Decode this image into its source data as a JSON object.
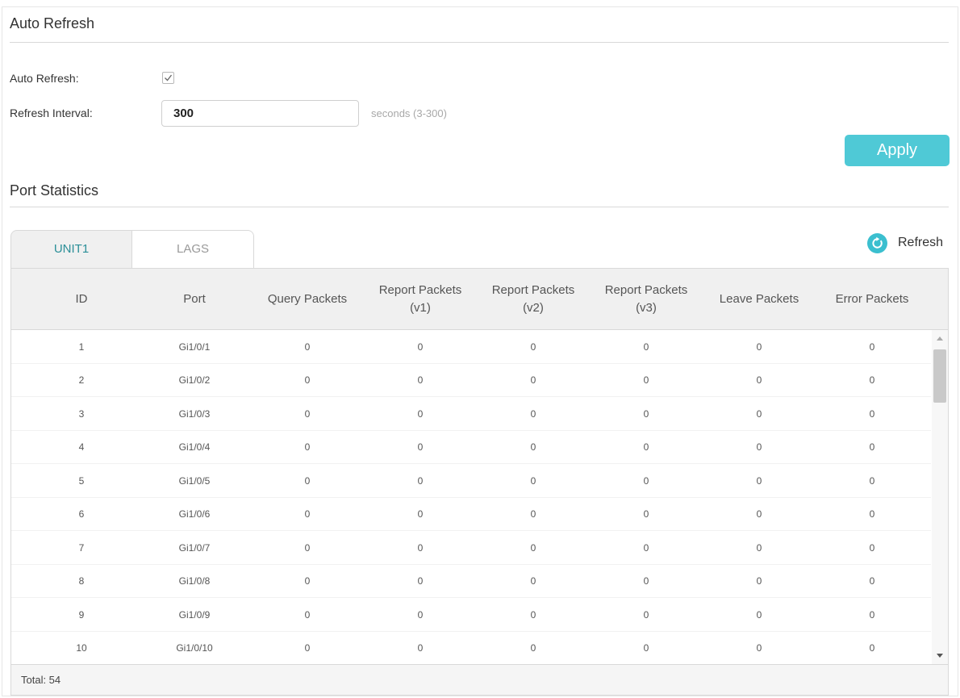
{
  "auto_refresh_section": {
    "title": "Auto Refresh",
    "auto_refresh_label": "Auto Refresh:",
    "auto_refresh_checked": true,
    "interval_label": "Refresh Interval:",
    "interval_value": "300",
    "interval_hint": "seconds (3-300)",
    "apply_label": "Apply"
  },
  "port_stats_section": {
    "title": "Port Statistics",
    "tabs": [
      {
        "label": "UNIT1",
        "active": true
      },
      {
        "label": "LAGS",
        "active": false
      }
    ],
    "refresh_label": "Refresh",
    "refresh_icon": "refresh-icon",
    "columns": [
      {
        "line1": "ID",
        "line2": ""
      },
      {
        "line1": "Port",
        "line2": ""
      },
      {
        "line1": "Query Packets",
        "line2": ""
      },
      {
        "line1": "Report Packets",
        "line2": "(v1)"
      },
      {
        "line1": "Report Packets",
        "line2": "(v2)"
      },
      {
        "line1": "Report Packets",
        "line2": "(v3)"
      },
      {
        "line1": "Leave Packets",
        "line2": ""
      },
      {
        "line1": "Error Packets",
        "line2": ""
      }
    ],
    "rows": [
      [
        "1",
        "Gi1/0/1",
        "0",
        "0",
        "0",
        "0",
        "0",
        "0"
      ],
      [
        "2",
        "Gi1/0/2",
        "0",
        "0",
        "0",
        "0",
        "0",
        "0"
      ],
      [
        "3",
        "Gi1/0/3",
        "0",
        "0",
        "0",
        "0",
        "0",
        "0"
      ],
      [
        "4",
        "Gi1/0/4",
        "0",
        "0",
        "0",
        "0",
        "0",
        "0"
      ],
      [
        "5",
        "Gi1/0/5",
        "0",
        "0",
        "0",
        "0",
        "0",
        "0"
      ],
      [
        "6",
        "Gi1/0/6",
        "0",
        "0",
        "0",
        "0",
        "0",
        "0"
      ],
      [
        "7",
        "Gi1/0/7",
        "0",
        "0",
        "0",
        "0",
        "0",
        "0"
      ],
      [
        "8",
        "Gi1/0/8",
        "0",
        "0",
        "0",
        "0",
        "0",
        "0"
      ],
      [
        "9",
        "Gi1/0/9",
        "0",
        "0",
        "0",
        "0",
        "0",
        "0"
      ],
      [
        "10",
        "Gi1/0/10",
        "0",
        "0",
        "0",
        "0",
        "0",
        "0"
      ]
    ],
    "total_label": "Total: 54"
  },
  "colors": {
    "accent": "#4fc9d6",
    "active_tab_text": "#2b8f98",
    "refresh_icon": "#3bbfcf"
  }
}
